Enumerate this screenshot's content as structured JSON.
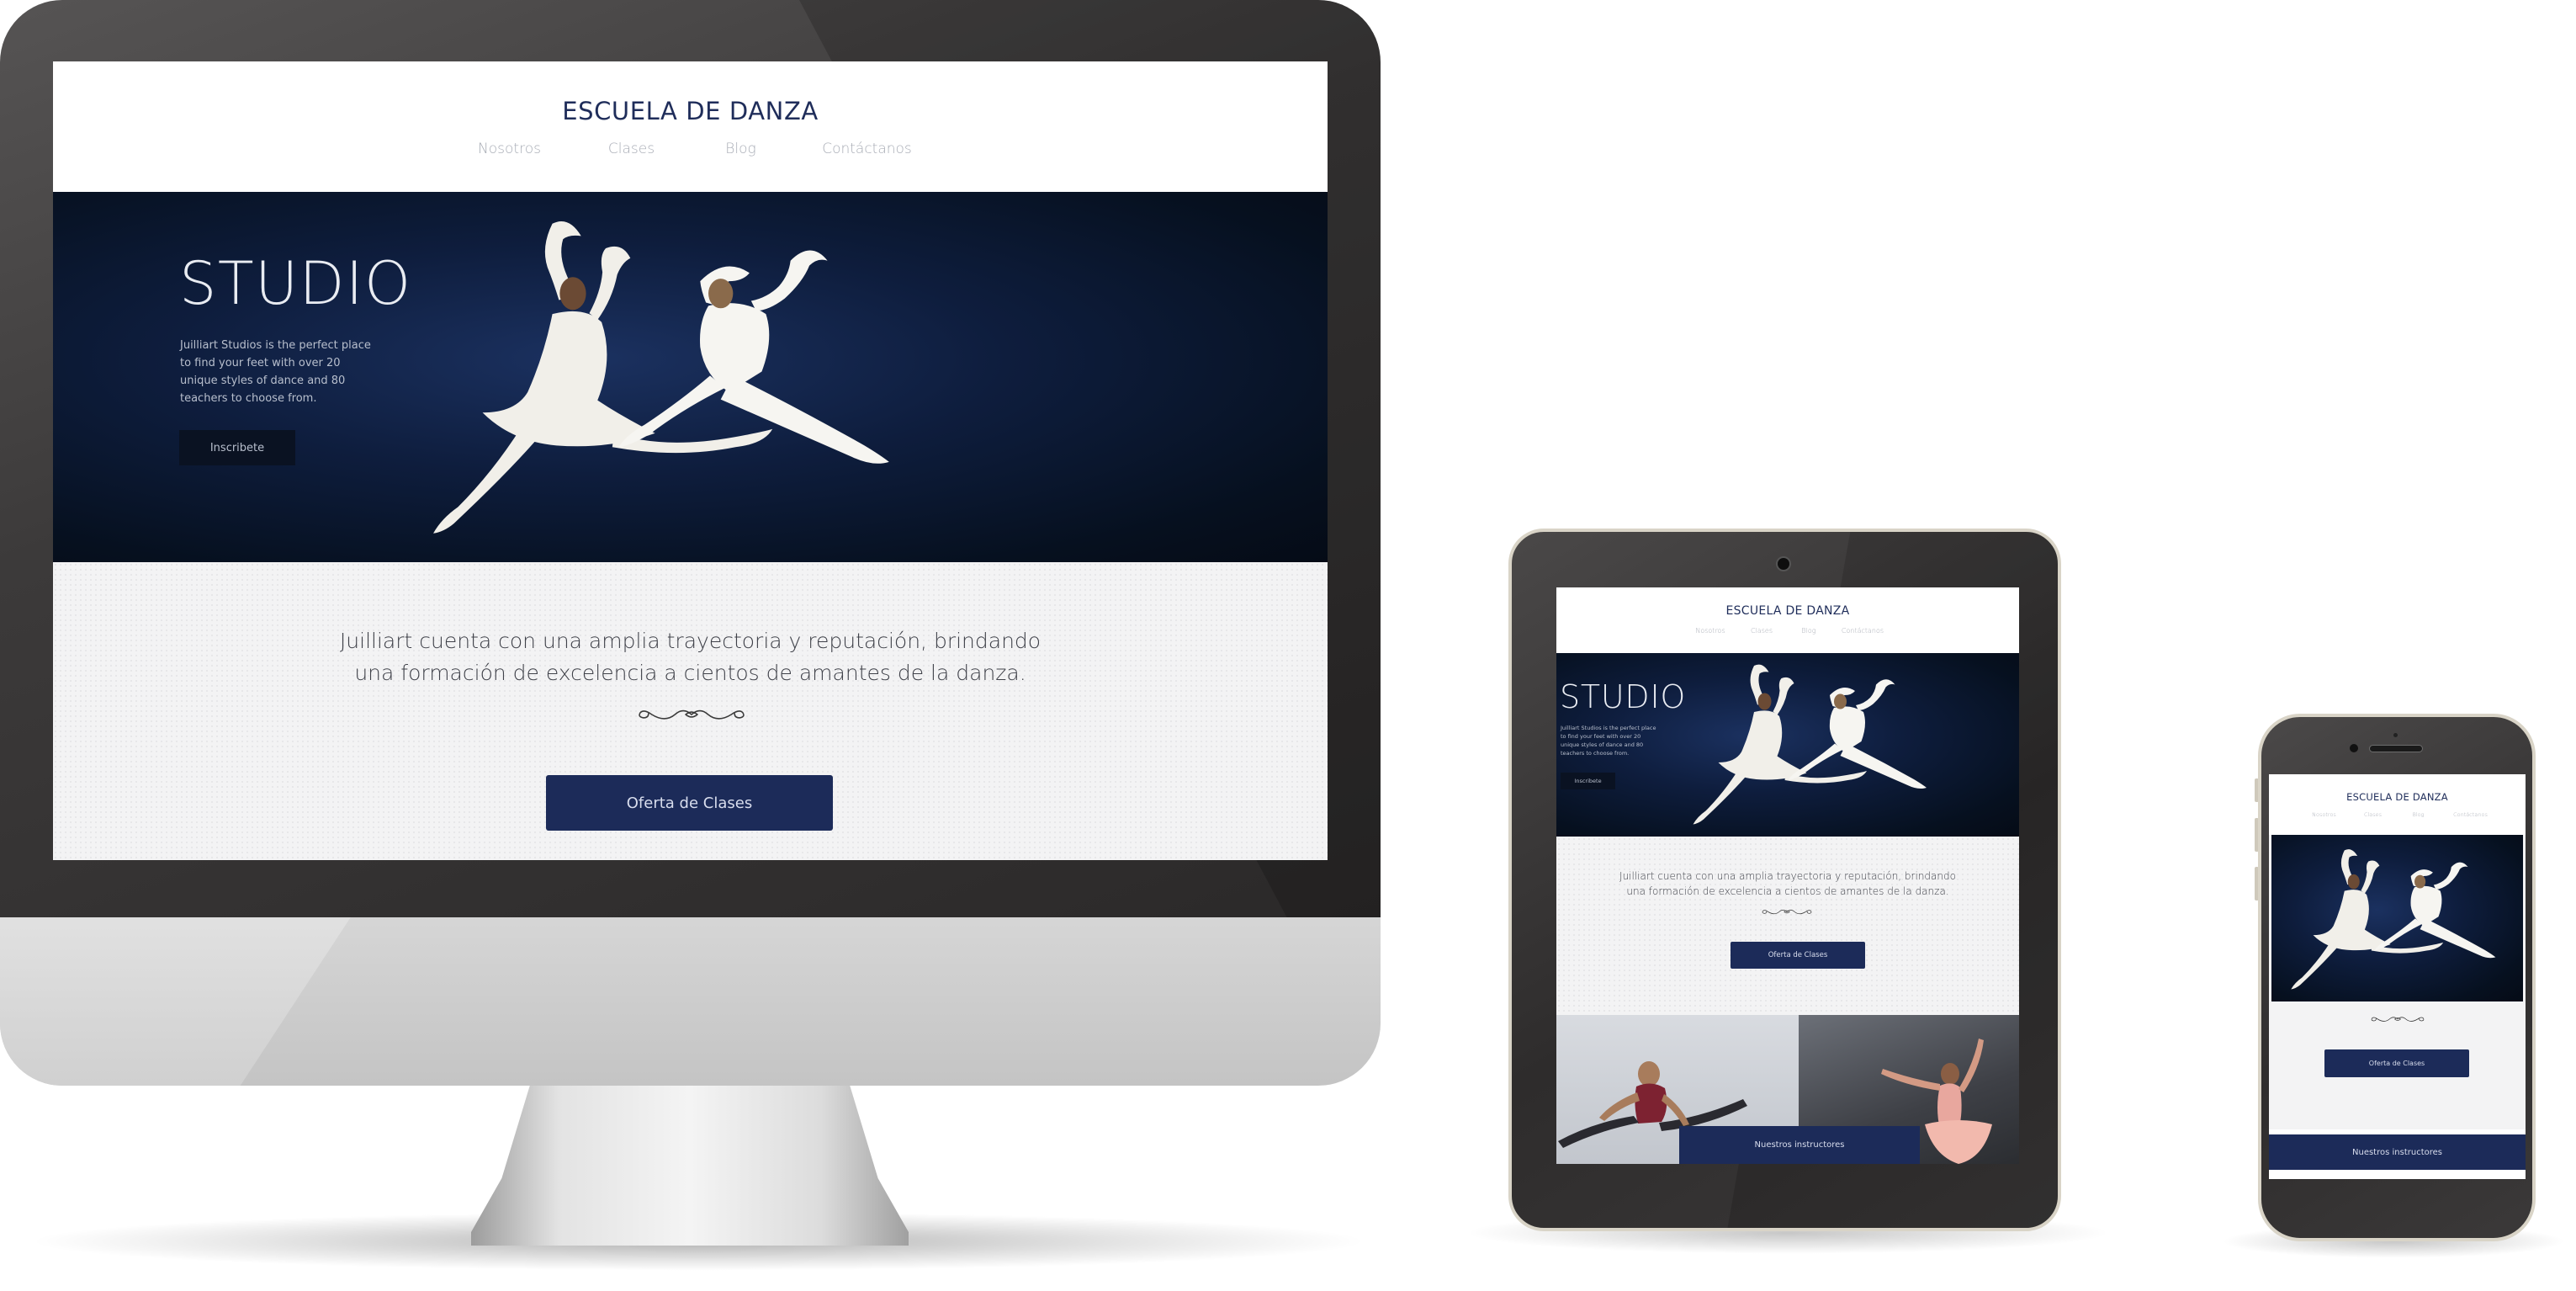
{
  "brand": "ESCUELA DE DANZA",
  "nav": [
    "Nosotros",
    "Clases",
    "Blog",
    "Contáctanos"
  ],
  "hero": {
    "title": "STUDIO",
    "text_lines": [
      "Juilliart Studios is the perfect place",
      "to find your feet with over 20",
      "unique styles of dance and 80",
      "teachers to choose from."
    ],
    "button": "Inscribete"
  },
  "intro": {
    "line1": "Juilliart cuenta con una amplia trayectoria y reputación, brindando",
    "line2": "una formación de excelencia a cientos de amantes de la danza."
  },
  "cta": "Oferta de Clases",
  "instructors_button": "Nuestros instructores",
  "icons": {
    "ornament": "flourish-ornament-icon",
    "dancers": "dancing-couple-photo"
  },
  "colors": {
    "brand": "#1f2d5a",
    "button": "#1c2b59",
    "hero_bg": "#0e1d3d"
  }
}
